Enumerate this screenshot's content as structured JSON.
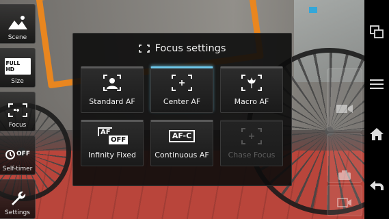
{
  "left_modes": [
    {
      "id": "scene",
      "label": "Scene",
      "icon": "scene-icon"
    },
    {
      "id": "size",
      "label": "Size",
      "icon": "full-hd-icon",
      "badge": "FULL HD"
    },
    {
      "id": "focus",
      "label": "Focus",
      "icon": "focus-frame-icon"
    },
    {
      "id": "self-timer",
      "label": "Self-timer",
      "icon": "timer-icon",
      "badge": "OFF"
    },
    {
      "id": "settings",
      "label": "Settings",
      "icon": "wrench-icon"
    }
  ],
  "dialog": {
    "title": "Focus settings",
    "options": [
      {
        "label": "Standard AF",
        "icon": "standard-af-icon",
        "state": "normal"
      },
      {
        "label": "Center AF",
        "icon": "center-af-icon",
        "state": "selected"
      },
      {
        "label": "Macro AF",
        "icon": "macro-af-icon",
        "state": "normal"
      },
      {
        "label": "Infinity Fixed",
        "icon": "infinity-fixed-icon",
        "state": "normal",
        "badge": "OFF",
        "sub": "AF"
      },
      {
        "label": "Continuous AF",
        "icon": "continuous-af-icon",
        "state": "normal",
        "sub": "AF-C"
      },
      {
        "label": "Chase Focus",
        "icon": "chase-focus-icon",
        "state": "disabled"
      }
    ],
    "selected_color": "#6ec7ea"
  },
  "system_bar": {
    "icons": [
      "recent-apps-icon",
      "menu-icon",
      "home-icon",
      "back-icon"
    ]
  },
  "camera_controls": {
    "icons": [
      "video-mode-icon",
      "shutter-icon",
      "record-icon"
    ]
  }
}
